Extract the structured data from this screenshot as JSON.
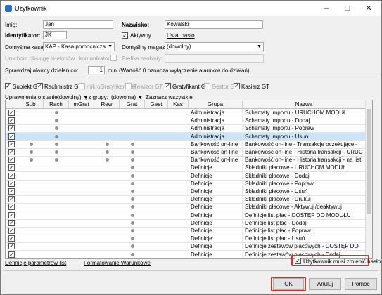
{
  "window": {
    "title": "Użytkownik"
  },
  "form": {
    "imie_label": "Imię:",
    "imie_value": "Jan",
    "nazwisko_label": "Nazwisko:",
    "nazwisko_value": "Kowalski",
    "identyfikator_label": "Identyfikator:",
    "identyfikator_value": "JK",
    "aktywny_label": "Aktywny",
    "aktywny_checked": true,
    "ustal_haslo": "Ustal hasło",
    "kasa_label": "Domyślna kasa:",
    "kasa_value": "KAP - Kasa pomocnicza",
    "magazyn_label": "Domyślny magazyn:",
    "magazyn_value": "(dowolny)",
    "telefon_label": "Uruchom obsługę telefonów i komunikatorów",
    "prefiks_label": "Prefiks osobisty:",
    "alarmy_label": "Sprawdzaj alarmy działań co:",
    "alarmy_value": "1",
    "alarmy_unit": "min",
    "alarmy_note": "(Wartość 0 oznacza wyłączenie alarmów do działań)"
  },
  "roles": [
    {
      "label": "Subiekt GT",
      "checked": true,
      "enabled": true
    },
    {
      "label": "Rachmistrz GT",
      "checked": true,
      "enabled": true
    },
    {
      "label": "mikroGratyfikant GT",
      "checked": false,
      "enabled": false
    },
    {
      "label": "Rewizor GT",
      "checked": false,
      "enabled": false
    },
    {
      "label": "Gratyfikant GT",
      "checked": true,
      "enabled": true
    },
    {
      "label": "Gestor GT",
      "checked": false,
      "enabled": false
    },
    {
      "label": "Kasiarz GT",
      "checked": true,
      "enabled": true
    }
  ],
  "filters": {
    "status_label": "Uprawnienia o stanie:",
    "status_value": "(dowolny)",
    "group_label": ", z grupy:",
    "group_value": "(dowolna)",
    "select_all": "Zaznacz wszystkie"
  },
  "grid": {
    "columns": [
      "",
      "Sub",
      "Rach",
      "mGrat",
      "Rew",
      "Grat",
      "Gest",
      "Kas",
      "Grupa",
      "Nazwa"
    ],
    "rows": [
      {
        "checked": true,
        "dots": [
          0,
          1,
          0,
          0,
          0,
          0,
          0
        ],
        "grupa": "Administracja",
        "nazwa": "Schematy importu - URUCHOM MODUŁ",
        "selected": false
      },
      {
        "checked": true,
        "dots": [
          0,
          1,
          0,
          0,
          0,
          0,
          0
        ],
        "grupa": "Administracja",
        "nazwa": "Schematy importu - Dodaj",
        "selected": false
      },
      {
        "checked": true,
        "dots": [
          0,
          1,
          0,
          0,
          0,
          0,
          0
        ],
        "grupa": "Administracja",
        "nazwa": "Schematy importu - Popraw",
        "selected": false
      },
      {
        "checked": true,
        "dots": [
          0,
          1,
          0,
          0,
          0,
          0,
          0
        ],
        "grupa": "Administracja",
        "nazwa": "Schematy importu - Usuń",
        "selected": true
      },
      {
        "checked": true,
        "dots": [
          1,
          1,
          0,
          1,
          1,
          0,
          0
        ],
        "grupa": "Bankowość on-line",
        "nazwa": "Bankowość on-line - Transakcje oczekujące -",
        "selected": false
      },
      {
        "checked": true,
        "dots": [
          1,
          1,
          0,
          1,
          1,
          0,
          0
        ],
        "grupa": "Bankowość on-line",
        "nazwa": "Bankowość on-line - Historia transakcji - URUC",
        "selected": false
      },
      {
        "checked": true,
        "dots": [
          1,
          1,
          0,
          1,
          1,
          0,
          0
        ],
        "grupa": "Bankowość on-line",
        "nazwa": "Bankowość on-line - Historia transakcji - na list",
        "selected": false
      },
      {
        "checked": true,
        "dots": [
          0,
          0,
          0,
          0,
          1,
          0,
          0
        ],
        "grupa": "Definicje",
        "nazwa": "Składniki płacowe - URUCHOM MODUŁ",
        "selected": false
      },
      {
        "checked": true,
        "dots": [
          0,
          0,
          0,
          0,
          1,
          0,
          0
        ],
        "grupa": "Definicje",
        "nazwa": "Składniki płacowe - Dodaj",
        "selected": false
      },
      {
        "checked": true,
        "dots": [
          0,
          0,
          0,
          0,
          1,
          0,
          0
        ],
        "grupa": "Definicje",
        "nazwa": "Składniki płacowe - Popraw",
        "selected": false
      },
      {
        "checked": true,
        "dots": [
          0,
          0,
          0,
          0,
          1,
          0,
          0
        ],
        "grupa": "Definicje",
        "nazwa": "Składniki płacowe - Usuń",
        "selected": false
      },
      {
        "checked": true,
        "dots": [
          0,
          0,
          0,
          0,
          1,
          0,
          0
        ],
        "grupa": "Definicje",
        "nazwa": "Składniki płacowe - Drukuj",
        "selected": false
      },
      {
        "checked": true,
        "dots": [
          0,
          0,
          0,
          0,
          1,
          0,
          0
        ],
        "grupa": "Definicje",
        "nazwa": "Składniki płacowe - Aktywuj /deaktywuj",
        "selected": false
      },
      {
        "checked": true,
        "dots": [
          0,
          0,
          0,
          0,
          1,
          0,
          0
        ],
        "grupa": "Definicje",
        "nazwa": "Definicje list płac - DOSTĘP DO MODUŁU",
        "selected": false
      },
      {
        "checked": true,
        "dots": [
          0,
          0,
          0,
          0,
          1,
          0,
          0
        ],
        "grupa": "Definicje",
        "nazwa": "Definicje list płac - Dodaj",
        "selected": false
      },
      {
        "checked": true,
        "dots": [
          0,
          0,
          0,
          0,
          1,
          0,
          0
        ],
        "grupa": "Definicje",
        "nazwa": "Definicje list płac - Popraw",
        "selected": false
      },
      {
        "checked": true,
        "dots": [
          0,
          0,
          0,
          0,
          1,
          0,
          0
        ],
        "grupa": "Definicje",
        "nazwa": "Definicje list płac - Usuń",
        "selected": false
      },
      {
        "checked": true,
        "dots": [
          0,
          0,
          0,
          0,
          1,
          0,
          0
        ],
        "grupa": "Definicje",
        "nazwa": "Definicje zestawów płacowych - DOSTĘP DO",
        "selected": false
      },
      {
        "checked": true,
        "dots": [
          0,
          0,
          0,
          0,
          1,
          0,
          0
        ],
        "grupa": "Definicje",
        "nazwa": "Definicje zestawów płacowych - Dodaj",
        "selected": false
      }
    ]
  },
  "bottom": {
    "link1": "Definicje parametrów list",
    "link2": "Formatowanie Warunkowe",
    "must_change_label": "Użytkownik musi zmienić hasło",
    "must_change_checked": true
  },
  "buttons": {
    "ok": "OK",
    "cancel": "Anuluj",
    "help": "Pomoc"
  },
  "colors": {
    "highlight": "#d9302c",
    "selected_row": "#cce4f7"
  }
}
